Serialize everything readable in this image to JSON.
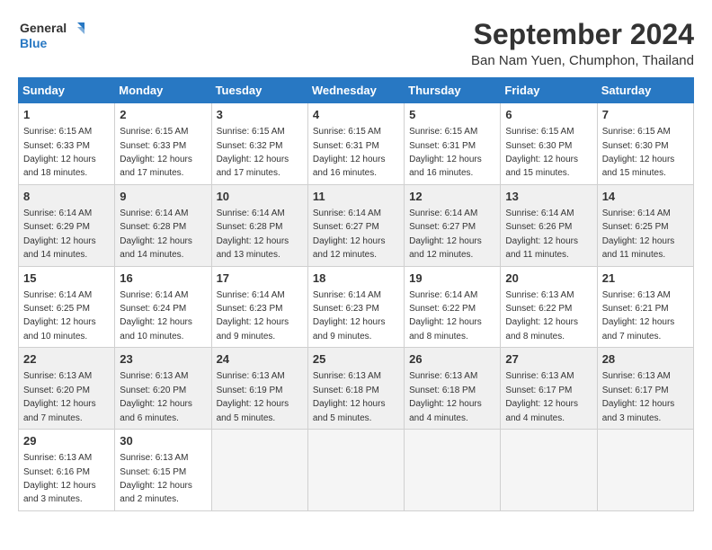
{
  "logo": {
    "line1": "General",
    "line2": "Blue"
  },
  "title": "September 2024",
  "location": "Ban Nam Yuen, Chumphon, Thailand",
  "weekdays": [
    "Sunday",
    "Monday",
    "Tuesday",
    "Wednesday",
    "Thursday",
    "Friday",
    "Saturday"
  ],
  "weeks": [
    [
      {
        "day": "1",
        "sunrise": "6:15 AM",
        "sunset": "6:33 PM",
        "daylight": "12 hours and 18 minutes."
      },
      {
        "day": "2",
        "sunrise": "6:15 AM",
        "sunset": "6:33 PM",
        "daylight": "12 hours and 17 minutes."
      },
      {
        "day": "3",
        "sunrise": "6:15 AM",
        "sunset": "6:32 PM",
        "daylight": "12 hours and 17 minutes."
      },
      {
        "day": "4",
        "sunrise": "6:15 AM",
        "sunset": "6:31 PM",
        "daylight": "12 hours and 16 minutes."
      },
      {
        "day": "5",
        "sunrise": "6:15 AM",
        "sunset": "6:31 PM",
        "daylight": "12 hours and 16 minutes."
      },
      {
        "day": "6",
        "sunrise": "6:15 AM",
        "sunset": "6:30 PM",
        "daylight": "12 hours and 15 minutes."
      },
      {
        "day": "7",
        "sunrise": "6:15 AM",
        "sunset": "6:30 PM",
        "daylight": "12 hours and 15 minutes."
      }
    ],
    [
      {
        "day": "8",
        "sunrise": "6:14 AM",
        "sunset": "6:29 PM",
        "daylight": "12 hours and 14 minutes."
      },
      {
        "day": "9",
        "sunrise": "6:14 AM",
        "sunset": "6:28 PM",
        "daylight": "12 hours and 14 minutes."
      },
      {
        "day": "10",
        "sunrise": "6:14 AM",
        "sunset": "6:28 PM",
        "daylight": "12 hours and 13 minutes."
      },
      {
        "day": "11",
        "sunrise": "6:14 AM",
        "sunset": "6:27 PM",
        "daylight": "12 hours and 12 minutes."
      },
      {
        "day": "12",
        "sunrise": "6:14 AM",
        "sunset": "6:27 PM",
        "daylight": "12 hours and 12 minutes."
      },
      {
        "day": "13",
        "sunrise": "6:14 AM",
        "sunset": "6:26 PM",
        "daylight": "12 hours and 11 minutes."
      },
      {
        "day": "14",
        "sunrise": "6:14 AM",
        "sunset": "6:25 PM",
        "daylight": "12 hours and 11 minutes."
      }
    ],
    [
      {
        "day": "15",
        "sunrise": "6:14 AM",
        "sunset": "6:25 PM",
        "daylight": "12 hours and 10 minutes."
      },
      {
        "day": "16",
        "sunrise": "6:14 AM",
        "sunset": "6:24 PM",
        "daylight": "12 hours and 10 minutes."
      },
      {
        "day": "17",
        "sunrise": "6:14 AM",
        "sunset": "6:23 PM",
        "daylight": "12 hours and 9 minutes."
      },
      {
        "day": "18",
        "sunrise": "6:14 AM",
        "sunset": "6:23 PM",
        "daylight": "12 hours and 9 minutes."
      },
      {
        "day": "19",
        "sunrise": "6:14 AM",
        "sunset": "6:22 PM",
        "daylight": "12 hours and 8 minutes."
      },
      {
        "day": "20",
        "sunrise": "6:13 AM",
        "sunset": "6:22 PM",
        "daylight": "12 hours and 8 minutes."
      },
      {
        "day": "21",
        "sunrise": "6:13 AM",
        "sunset": "6:21 PM",
        "daylight": "12 hours and 7 minutes."
      }
    ],
    [
      {
        "day": "22",
        "sunrise": "6:13 AM",
        "sunset": "6:20 PM",
        "daylight": "12 hours and 7 minutes."
      },
      {
        "day": "23",
        "sunrise": "6:13 AM",
        "sunset": "6:20 PM",
        "daylight": "12 hours and 6 minutes."
      },
      {
        "day": "24",
        "sunrise": "6:13 AM",
        "sunset": "6:19 PM",
        "daylight": "12 hours and 5 minutes."
      },
      {
        "day": "25",
        "sunrise": "6:13 AM",
        "sunset": "6:18 PM",
        "daylight": "12 hours and 5 minutes."
      },
      {
        "day": "26",
        "sunrise": "6:13 AM",
        "sunset": "6:18 PM",
        "daylight": "12 hours and 4 minutes."
      },
      {
        "day": "27",
        "sunrise": "6:13 AM",
        "sunset": "6:17 PM",
        "daylight": "12 hours and 4 minutes."
      },
      {
        "day": "28",
        "sunrise": "6:13 AM",
        "sunset": "6:17 PM",
        "daylight": "12 hours and 3 minutes."
      }
    ],
    [
      {
        "day": "29",
        "sunrise": "6:13 AM",
        "sunset": "6:16 PM",
        "daylight": "12 hours and 3 minutes."
      },
      {
        "day": "30",
        "sunrise": "6:13 AM",
        "sunset": "6:15 PM",
        "daylight": "12 hours and 2 minutes."
      },
      null,
      null,
      null,
      null,
      null
    ]
  ]
}
